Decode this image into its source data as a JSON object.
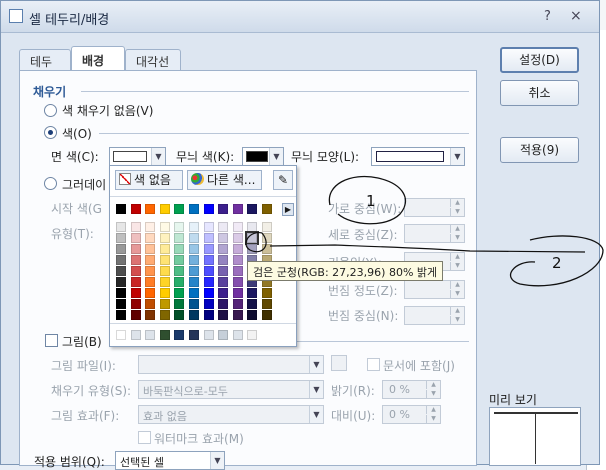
{
  "dialog": {
    "title": "셀 테두리/배경",
    "help": "?",
    "close": "×"
  },
  "tabs": [
    "테두리",
    "배경",
    "대각선"
  ],
  "fill": {
    "section": "채우기",
    "no_fill": "색 채우기 없음(V)",
    "color": "색(O)",
    "face_color": "면 색(C):",
    "pattern_color": "무늬 색(K):",
    "pattern_shape": "무늬 모양(L):",
    "gradient": "그러데이",
    "start_color": "시작 색(G",
    "type": "유형(T):",
    "h_center": "가로 중심(W):",
    "v_center": "세로 중심(Z):",
    "tilt": "기울임(Y):",
    "change_level": "번짐 정도(Z):",
    "spread_center": "번짐 중심(N):"
  },
  "picture": {
    "label": "그림(B)",
    "file": "그림 파일(I):",
    "include_doc": "문서에 포함(J)",
    "fill_type": "채우기 유형(S):",
    "fill_type_value": "바둑판식으로-모두",
    "brightness": "밝기(R):",
    "brightness_value": "0 %",
    "effect": "그림 효과(F):",
    "effect_value": "효과 없음",
    "contrast": "대비(U):",
    "contrast_value": "0 %",
    "watermark": "워터마크 효과(M)"
  },
  "scope": {
    "label": "적용 범위(Q):",
    "value": "선택된 셀"
  },
  "buttons": {
    "ok": "설정(D)",
    "cancel": "취소",
    "apply": "적용(9)"
  },
  "preview": {
    "label": "미리 보기"
  },
  "picker": {
    "no_color": "색 없음",
    "other_color": "다른 색...",
    "tooltip": "검은 군청(RGB: 27,23,96) 80% 밝게",
    "top_row": [
      "#000000",
      "#c00000",
      "#ff6600",
      "#ffcc00",
      "#00a050",
      "#0070c0",
      "#0000ff",
      "#3c1f8c",
      "#7030a0",
      "#1b1760",
      "#7f6000"
    ],
    "recent": [
      "#ffffff",
      "#dde3ea",
      "#dde3ea",
      "#2f4f2f",
      "#1b3a6b",
      "#243458",
      "#dde3ea",
      "#c6cfd9",
      "#dde3ea",
      "#f3f3f3"
    ]
  },
  "annotations": [
    "1",
    "2"
  ],
  "colors": {
    "accent": "#2e5a96",
    "pattern_swatch": "#000000"
  }
}
